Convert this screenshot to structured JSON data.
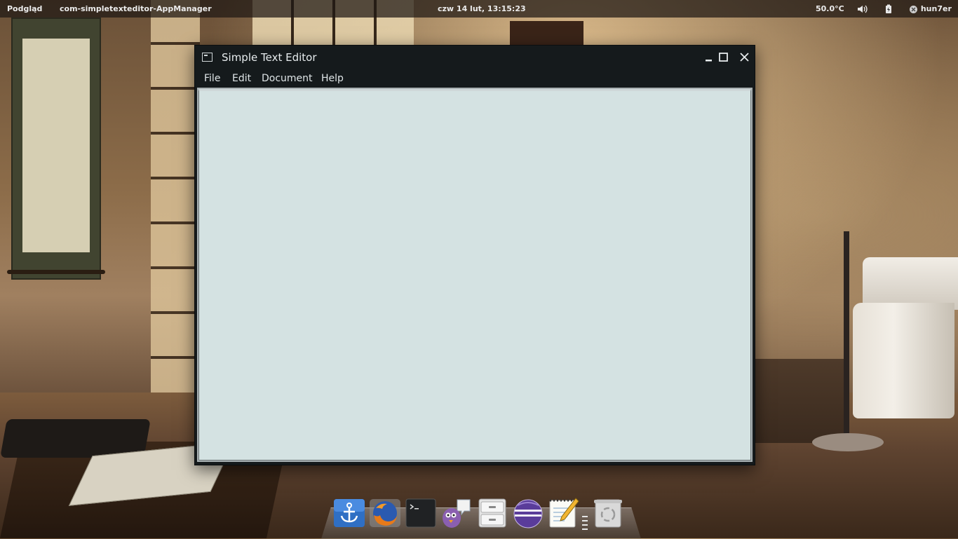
{
  "top_panel": {
    "activities_label": "Podgląd",
    "app_name": "com-simpletexteditor-AppManager",
    "clock": "czw 14 lut, 13:15:23",
    "temperature": "50.0°C",
    "user_name": "hun7er"
  },
  "window": {
    "title": "Simple Text Editor",
    "menu": [
      "File",
      "Edit",
      "Document",
      "Help"
    ],
    "editor_content": ""
  },
  "dock": {
    "items": [
      "anchor-app",
      "firefox",
      "terminal",
      "pidgin",
      "file-cabinet",
      "eclipse",
      "text-editor",
      "trash"
    ]
  }
}
